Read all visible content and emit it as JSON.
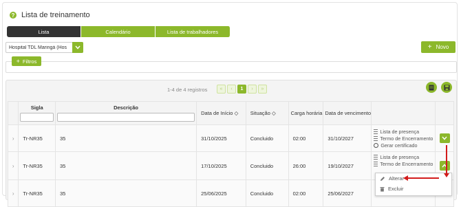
{
  "title": "Lista de treinamento",
  "tabs": [
    "Lista",
    "Calendário",
    "Lista de trabalhadores"
  ],
  "unit_select": {
    "value": "Hospital TDL Maringá (Hos"
  },
  "new_button": "Novo",
  "filters_button": "Filtros",
  "pagination": {
    "records": "1-4 de 4 registros",
    "current": "1"
  },
  "columns": {
    "sigla": "Sigla",
    "descricao": "Descrição",
    "data_inicio": "Data de Início",
    "situacao": "Situação",
    "carga": "Carga horária",
    "vencimento": "Data de vencimento"
  },
  "rows": [
    {
      "sigla": "Tr-NR35",
      "descricao": "35",
      "inicio": "31/10/2025",
      "situacao": "Concluido",
      "carga": "02:00",
      "vencimento": "31/10/2027"
    },
    {
      "sigla": "Tr-NR35",
      "descricao": "35",
      "inicio": "17/10/2025",
      "situacao": "Concluido",
      "carga": "26:00",
      "vencimento": "19/10/2027"
    },
    {
      "sigla": "Tr-NR35",
      "descricao": "35",
      "inicio": "25/06/2025",
      "situacao": "Concluido",
      "carga": "02:00",
      "vencimento": "25/06/2027"
    }
  ],
  "row_actions": {
    "presenca": "Lista de presença",
    "termo": "Termo de Encerramento",
    "certificado": "Gerar certificado"
  },
  "dropdown": {
    "alterar": "Alterar",
    "excluir": "Excluir"
  },
  "colors": {
    "accent": "#8cb82b",
    "dark_tab": "#333333",
    "annotation": "#d21b1b"
  }
}
